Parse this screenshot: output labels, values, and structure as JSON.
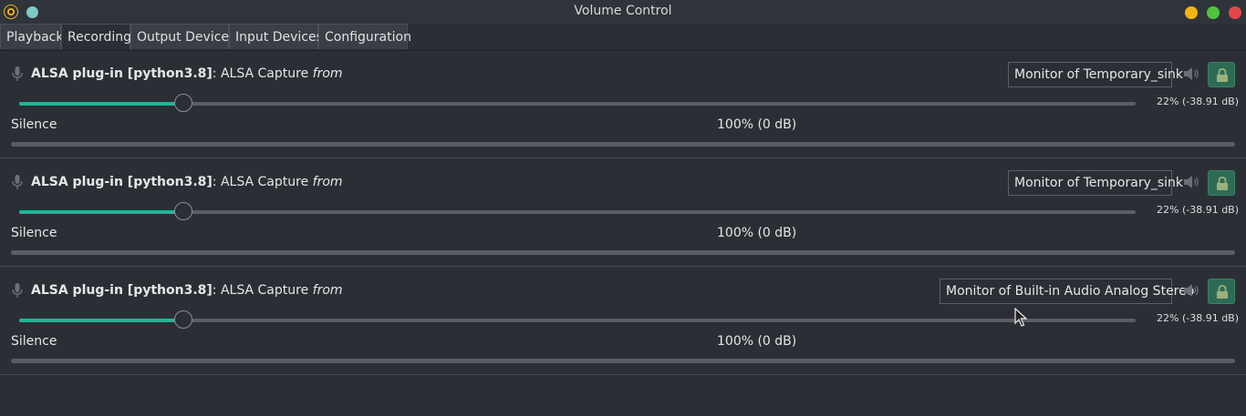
{
  "window": {
    "title": "Volume Control"
  },
  "tabs": [
    {
      "label": "Playback",
      "active": false
    },
    {
      "label": "Recording",
      "active": true
    },
    {
      "label": "Output Devices",
      "active": false
    },
    {
      "label": "Input Devices",
      "active": false
    },
    {
      "label": "Configuration",
      "active": false
    }
  ],
  "colors": {
    "accent": "#1fb696",
    "lock_button": "#2e6b55",
    "background": "#2b2f35"
  },
  "streams": [
    {
      "app": "ALSA plug-in [python3.8]",
      "separator": ": ALSA Capture ",
      "from_label": "from",
      "device": "Monitor of Temporary_sink",
      "volume_fraction": 0.147,
      "volume_readout": "22% (-38.91 dB)",
      "silence_label": "Silence",
      "center_label": "100% (0 dB)"
    },
    {
      "app": "ALSA plug-in [python3.8]",
      "separator": ": ALSA Capture ",
      "from_label": "from",
      "device": "Monitor of Temporary_sink",
      "volume_fraction": 0.147,
      "volume_readout": "22% (-38.91 dB)",
      "silence_label": "Silence",
      "center_label": "100% (0 dB)"
    },
    {
      "app": "ALSA plug-in [python3.8]",
      "separator": ": ALSA Capture ",
      "from_label": "from",
      "device": "Monitor of Built-in Audio Analog Stereo",
      "volume_fraction": 0.147,
      "volume_readout": "22% (-38.91 dB)",
      "silence_label": "Silence",
      "center_label": "100% (0 dB)"
    }
  ],
  "icons": {
    "app": "volume-control-app-icon",
    "mic": "microphone-icon",
    "mute": "speaker-mute-icon",
    "lock": "lock-icon"
  }
}
